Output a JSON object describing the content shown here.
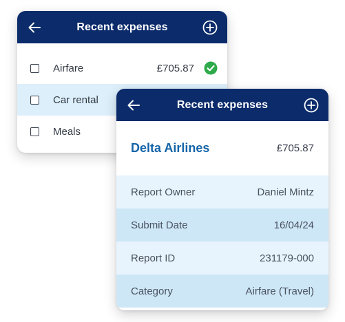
{
  "list_card": {
    "title": "Recent expenses",
    "back_icon": "arrow-left-icon",
    "add_icon": "plus-circle-icon",
    "items": [
      {
        "label": "Airfare",
        "amount": "£705.87",
        "status_icon": "check-circle-icon",
        "status_color": "#2eaa4a"
      },
      {
        "label": "Car rental"
      },
      {
        "label": "Meals"
      }
    ]
  },
  "detail_card": {
    "title": "Recent expenses",
    "back_icon": "arrow-left-icon",
    "add_icon": "plus-circle-icon",
    "vendor": "Delta Airlines",
    "amount": "£705.87",
    "fields": [
      {
        "label": "Report Owner",
        "value": "Daniel Mintz"
      },
      {
        "label": "Submit Date",
        "value": "16/04/24"
      },
      {
        "label": "Report ID",
        "value": "231179-000"
      },
      {
        "label": "Category",
        "value": "Airfare (Travel)"
      }
    ]
  },
  "colors": {
    "header": "#0b2b6b",
    "highlight_row": "#dceffb",
    "field_light": "#e7f4fd",
    "field_dark": "#cde7f7",
    "vendor_text": "#1565a8",
    "success": "#2eaa4a"
  }
}
